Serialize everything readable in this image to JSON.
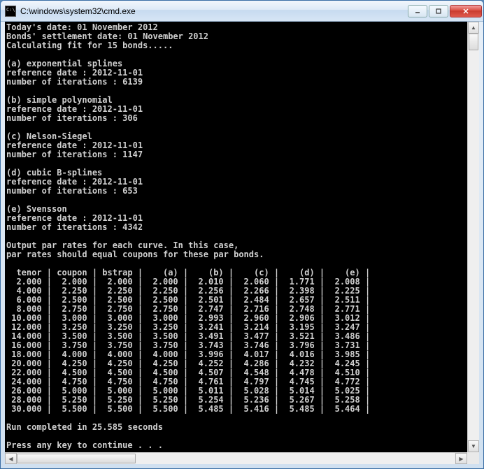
{
  "window": {
    "title": "C:\\windows\\system32\\cmd.exe"
  },
  "intro": {
    "today": "Today's date: 01 November 2012",
    "settlement": "Bonds' settlement date: 01 November 2012",
    "calc": "Calculating fit for 15 bonds....."
  },
  "models": {
    "a": {
      "title": "(a) exponential splines",
      "ref": "reference date : 2012-11-01",
      "iter": "number of iterations : 6139"
    },
    "b": {
      "title": "(b) simple polynomial",
      "ref": "reference date : 2012-11-01",
      "iter": "number of iterations : 306"
    },
    "c": {
      "title": "(c) Nelson-Siegel",
      "ref": "reference date : 2012-11-01",
      "iter": "number of iterations : 1147"
    },
    "d": {
      "title": "(d) cubic B-splines",
      "ref": "reference date : 2012-11-01",
      "iter": "number of iterations : 653"
    },
    "e": {
      "title": "(e) Svensson",
      "ref": "reference date : 2012-11-01",
      "iter": "number of iterations : 4342"
    }
  },
  "output_hdr1": "Output par rates for each curve. In this case,",
  "output_hdr2": "par rates should equal coupons for these par bonds.",
  "table": {
    "header": "  tenor | coupon | bstrap |    (a) |    (b) |    (c) |    (d) |    (e) |",
    "rows": [
      "  2.000 |  2.000 |  2.000 |  2.000 |  2.010 |  2.060 |  1.771 |  2.008 |",
      "  4.000 |  2.250 |  2.250 |  2.250 |  2.256 |  2.266 |  2.398 |  2.225 |",
      "  6.000 |  2.500 |  2.500 |  2.500 |  2.501 |  2.484 |  2.657 |  2.511 |",
      "  8.000 |  2.750 |  2.750 |  2.750 |  2.747 |  2.716 |  2.748 |  2.771 |",
      " 10.000 |  3.000 |  3.000 |  3.000 |  2.993 |  2.960 |  2.906 |  3.012 |",
      " 12.000 |  3.250 |  3.250 |  3.250 |  3.241 |  3.214 |  3.195 |  3.247 |",
      " 14.000 |  3.500 |  3.500 |  3.500 |  3.491 |  3.477 |  3.521 |  3.486 |",
      " 16.000 |  3.750 |  3.750 |  3.750 |  3.743 |  3.746 |  3.796 |  3.731 |",
      " 18.000 |  4.000 |  4.000 |  4.000 |  3.996 |  4.017 |  4.016 |  3.985 |",
      " 20.000 |  4.250 |  4.250 |  4.250 |  4.252 |  4.286 |  4.232 |  4.245 |",
      " 22.000 |  4.500 |  4.500 |  4.500 |  4.507 |  4.548 |  4.478 |  4.510 |",
      " 24.000 |  4.750 |  4.750 |  4.750 |  4.761 |  4.797 |  4.745 |  4.772 |",
      " 26.000 |  5.000 |  5.000 |  5.000 |  5.011 |  5.028 |  5.014 |  5.025 |",
      " 28.000 |  5.250 |  5.250 |  5.250 |  5.254 |  5.236 |  5.267 |  5.258 |",
      " 30.000 |  5.500 |  5.500 |  5.500 |  5.485 |  5.416 |  5.485 |  5.464 |"
    ]
  },
  "footer": {
    "runtime": "Run completed in 25.585 seconds",
    "prompt": "Press any key to continue . . ."
  },
  "chart_data": {
    "type": "table",
    "title": "Output par rates for each curve",
    "columns": [
      "tenor",
      "coupon",
      "bstrap",
      "(a)",
      "(b)",
      "(c)",
      "(d)",
      "(e)"
    ],
    "rows": [
      [
        2.0,
        2.0,
        2.0,
        2.0,
        2.01,
        2.06,
        1.771,
        2.008
      ],
      [
        4.0,
        2.25,
        2.25,
        2.25,
        2.256,
        2.266,
        2.398,
        2.225
      ],
      [
        6.0,
        2.5,
        2.5,
        2.5,
        2.501,
        2.484,
        2.657,
        2.511
      ],
      [
        8.0,
        2.75,
        2.75,
        2.75,
        2.747,
        2.716,
        2.748,
        2.771
      ],
      [
        10.0,
        3.0,
        3.0,
        3.0,
        2.993,
        2.96,
        2.906,
        3.012
      ],
      [
        12.0,
        3.25,
        3.25,
        3.25,
        3.241,
        3.214,
        3.195,
        3.247
      ],
      [
        14.0,
        3.5,
        3.5,
        3.5,
        3.491,
        3.477,
        3.521,
        3.486
      ],
      [
        16.0,
        3.75,
        3.75,
        3.75,
        3.743,
        3.746,
        3.796,
        3.731
      ],
      [
        18.0,
        4.0,
        4.0,
        4.0,
        3.996,
        4.017,
        4.016,
        3.985
      ],
      [
        20.0,
        4.25,
        4.25,
        4.25,
        4.252,
        4.286,
        4.232,
        4.245
      ],
      [
        22.0,
        4.5,
        4.5,
        4.5,
        4.507,
        4.548,
        4.478,
        4.51
      ],
      [
        24.0,
        4.75,
        4.75,
        4.75,
        4.761,
        4.797,
        4.745,
        4.772
      ],
      [
        26.0,
        5.0,
        5.0,
        5.0,
        5.011,
        5.028,
        5.014,
        5.025
      ],
      [
        28.0,
        5.25,
        5.25,
        5.25,
        5.254,
        5.236,
        5.267,
        5.258
      ],
      [
        30.0,
        5.5,
        5.5,
        5.5,
        5.485,
        5.416,
        5.485,
        5.464
      ]
    ]
  }
}
